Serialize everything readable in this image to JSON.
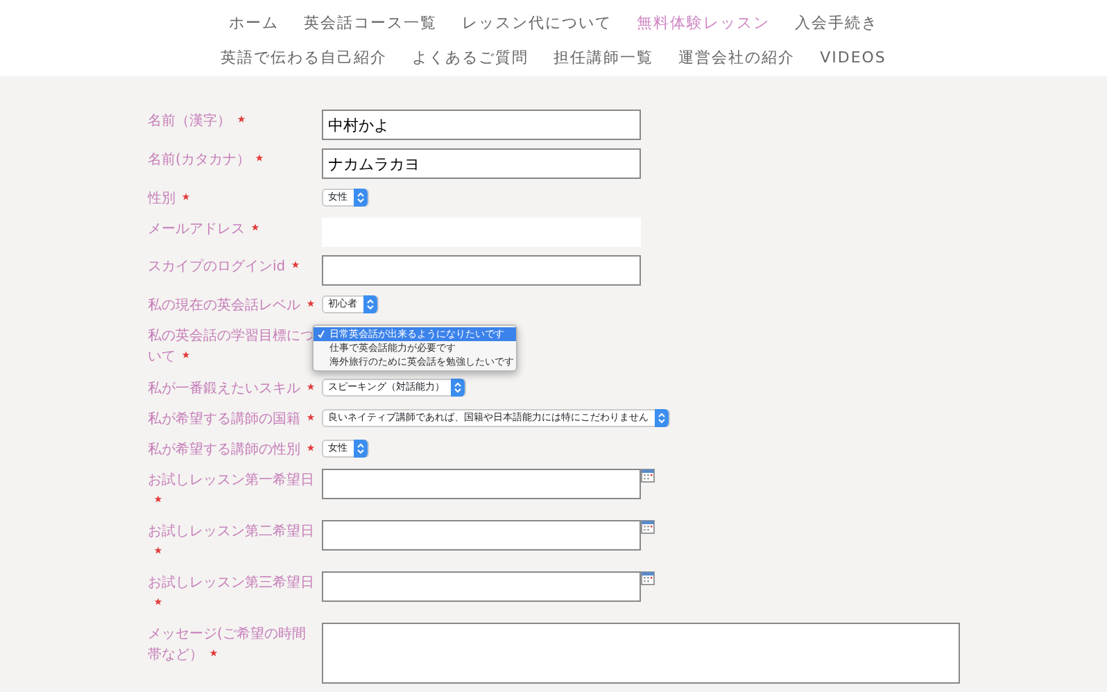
{
  "nav": {
    "rows": [
      [
        {
          "label": "ホーム",
          "selected": false
        },
        {
          "label": "英会話コース一覧",
          "selected": false
        },
        {
          "label": "レッスン代について",
          "selected": false
        },
        {
          "label": "無料体験レッスン",
          "selected": true
        },
        {
          "label": "入会手続き",
          "selected": false
        }
      ],
      [
        {
          "label": "英語で伝わる自己紹介",
          "selected": false
        },
        {
          "label": "よくあるご質問",
          "selected": false
        },
        {
          "label": "担任講師一覧",
          "selected": false
        },
        {
          "label": "運営会社の紹介",
          "selected": false
        },
        {
          "label": "VIDEOS",
          "selected": false
        }
      ]
    ]
  },
  "form": {
    "fields": [
      {
        "kind": "text",
        "label": "名前（漢字）",
        "required": true,
        "value": "中村かよ"
      },
      {
        "kind": "text",
        "label": "名前(カタカナ）",
        "required": true,
        "value": "ナカムラカヨ"
      },
      {
        "kind": "select",
        "label": "性別",
        "required": true,
        "value": "女性"
      },
      {
        "kind": "email",
        "label": "メールアドレス",
        "required": true
      },
      {
        "kind": "text",
        "label": "スカイプのログインid",
        "required": true
      },
      {
        "kind": "select",
        "label": "私の現在の英会話レベル",
        "required": true,
        "value": "初心者"
      },
      {
        "kind": "menu",
        "label": "私の英会話の学習目標について",
        "required": true,
        "options": [
          {
            "label": "日常英会話が出来るようになりたいです",
            "selected": true
          },
          {
            "label": "仕事で英会話能力が必要です",
            "selected": false
          },
          {
            "label": "海外旅行のために英会話を勉強したいです",
            "selected": false
          }
        ]
      },
      {
        "kind": "select",
        "label": "私が一番鍛えたいスキル",
        "required": true,
        "value": "スピーキング（対話能力）"
      },
      {
        "kind": "select",
        "label": "私が希望する講師の国籍",
        "required": true,
        "value": "良いネイティブ講師であれば、国籍や日本語能力には特にこだわりません"
      },
      {
        "kind": "select",
        "label": "私が希望する講師の性別",
        "required": true,
        "value": "女性"
      },
      {
        "kind": "date",
        "label": "お試しレッスン第一希望日",
        "required": true
      },
      {
        "kind": "date",
        "label": "お試しレッスン第二希望日",
        "required": true
      },
      {
        "kind": "date",
        "label": "お試しレッスン第三希望日",
        "required": true
      },
      {
        "kind": "textarea",
        "label": "メッセージ(ご希望の時間帯など）",
        "required": true
      }
    ]
  }
}
